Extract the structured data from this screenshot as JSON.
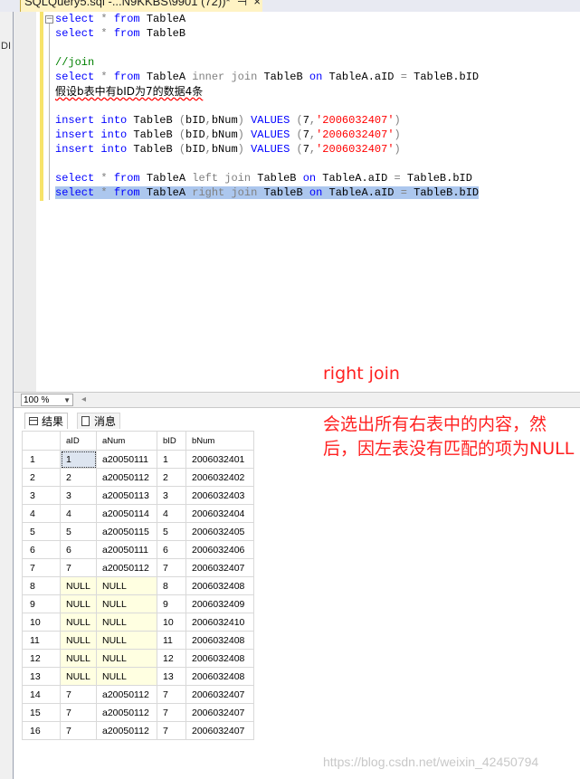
{
  "tab": {
    "title": "SQLQuery5.sql -...N9KKBS\\9901 (72))*",
    "pin": "⊣",
    "close": "×"
  },
  "left_strip": {
    "label": "DI"
  },
  "editor": {
    "fold_glyph": "−",
    "lines": [
      "select * from TableA",
      "select * from TableB",
      "",
      "//join",
      "select * from TableA inner join TableB on TableA.aID = TableB.bID",
      "假设b表中有bID为7的数据4条",
      "",
      "insert into TableB (bID,bNum) VALUES (7,'2006032407')",
      "insert into TableB (bID,bNum) VALUES (7,'2006032407')",
      "insert into TableB (bID,bNum) VALUES (7,'2006032407')",
      "",
      "select * from TableA left join TableB on TableA.aID = TableB.bID",
      "select * from TableA right join TableB on TableA.aID = TableB.bID"
    ]
  },
  "zoom": {
    "value": "100 %"
  },
  "results_tabs": {
    "results": "结果",
    "messages": "消息"
  },
  "grid": {
    "columns": [
      "aID",
      "aNum",
      "bID",
      "bNum"
    ],
    "rows": [
      [
        "1",
        "1",
        "a20050111",
        "1",
        "2006032401"
      ],
      [
        "2",
        "2",
        "a20050112",
        "2",
        "2006032402"
      ],
      [
        "3",
        "3",
        "a20050113",
        "3",
        "2006032403"
      ],
      [
        "4",
        "4",
        "a20050114",
        "4",
        "2006032404"
      ],
      [
        "5",
        "5",
        "a20050115",
        "5",
        "2006032405"
      ],
      [
        "6",
        "6",
        "a20050111",
        "6",
        "2006032406"
      ],
      [
        "7",
        "7",
        "a20050112",
        "7",
        "2006032407"
      ],
      [
        "8",
        "NULL",
        "NULL",
        "8",
        "2006032408"
      ],
      [
        "9",
        "NULL",
        "NULL",
        "9",
        "2006032409"
      ],
      [
        "10",
        "NULL",
        "NULL",
        "10",
        "2006032410"
      ],
      [
        "11",
        "NULL",
        "NULL",
        "11",
        "2006032408"
      ],
      [
        "12",
        "NULL",
        "NULL",
        "12",
        "2006032408"
      ],
      [
        "13",
        "NULL",
        "NULL",
        "13",
        "2006032408"
      ],
      [
        "14",
        "7",
        "a20050112",
        "7",
        "2006032407"
      ],
      [
        "15",
        "7",
        "a20050112",
        "7",
        "2006032407"
      ],
      [
        "16",
        "7",
        "a20050112",
        "7",
        "2006032407"
      ]
    ]
  },
  "annotation": {
    "title": "right join",
    "body": "会选出所有右表中的内容，然后，因左表没有匹配的项为NULL"
  },
  "watermark": "https://blog.csdn.net/weixin_42450794",
  "colors": {
    "keyword": "#0000ff",
    "string": "#ff0000",
    "comment": "#008000",
    "selection": "#acc7ee",
    "null_cell": "#ffffe1",
    "annotation": "#ff2020"
  }
}
